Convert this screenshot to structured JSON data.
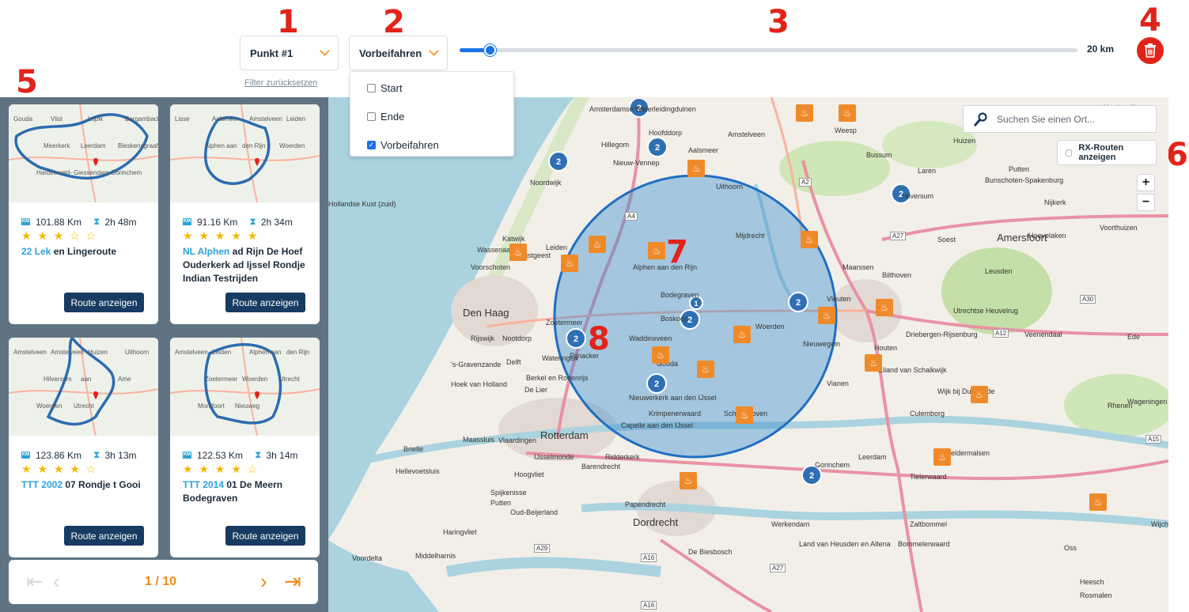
{
  "annotations": [
    "1",
    "2",
    "3",
    "4",
    "5",
    "6",
    "7",
    "8"
  ],
  "filters": {
    "point_select": {
      "value": "Punkt #1"
    },
    "mode_select": {
      "value": "Vorbeifahren"
    },
    "reset_label": "Filter zurücksetzen",
    "mode_options": [
      {
        "label": "Start",
        "checked": false
      },
      {
        "label": "Ende",
        "checked": false
      },
      {
        "label": "Vorbeifahren",
        "checked": true
      }
    ],
    "radius": {
      "value_km": 20,
      "min_km": 0,
      "max_km": 500,
      "label": "20 km"
    },
    "delete_icon": "trash-icon"
  },
  "routes": [
    {
      "km": "101.88 Km",
      "time": "2h 48m",
      "rating": 3,
      "stars": "★ ★ ★ ☆ ☆",
      "title_hl": "22 Lek",
      "title_rest": " en Lingeroute",
      "button": "Route anzeigen",
      "map_labels": [
        "Gouda",
        "Vlist",
        "Lopik",
        "Bergambacht",
        "Meerkerk",
        "Leerdam",
        "Bleskensgraaf",
        "Hardinxveld-",
        "Giessendam",
        "Gorinchem"
      ]
    },
    {
      "km": "91.16 Km",
      "time": "2h 34m",
      "rating": 5,
      "stars": "★ ★ ★ ★ ★",
      "title_hl": "NL Alphen",
      "title_rest": " ad Rijn De Hoef Ouderkerk ad Ijssel Rondje Indian Testrijden",
      "button": "Route anzeigen",
      "map_labels": [
        "Lisse",
        "Aalsmeer",
        "Amstelveen",
        "Leiden",
        "Alphen aan",
        "den Rijn",
        "Woerden"
      ]
    },
    {
      "km": "123.86 Km",
      "time": "3h 13m",
      "rating": 4,
      "stars": "★ ★ ★ ★ ☆",
      "title_hl": "TTT 2002",
      "title_rest": " 07 Rondje t Gooi",
      "button": "Route anzeigen",
      "map_labels": [
        "Amstelveen",
        "Amstelveen",
        "Huizen",
        "Uithoorn",
        "Hilversum",
        "aan",
        "Ame",
        "Woerden",
        "Utrecht"
      ]
    },
    {
      "km": "122.53 Km",
      "time": "3h 14m",
      "rating": 4,
      "stars": "★ ★ ★ ★ ☆",
      "title_hl": "TTT 2014",
      "title_rest": " 01 De Meern Bodegraven",
      "button": "Route anzeigen",
      "map_labels": [
        "Amstelveen",
        "Leiden",
        "Alphen aan",
        "den Rijn",
        "Zoetermeer",
        "Woerden",
        "Utrecht",
        "Montfoort",
        "Nieuweg"
      ]
    }
  ],
  "pagination": {
    "label": "1 / 10"
  },
  "map": {
    "search_placeholder": "Suchen Sie einen Ort...",
    "rx_label": "RX-Routen anzeigen",
    "zoom_in": "+",
    "zoom_out": "−",
    "cluster_counts": [
      "2",
      "2",
      "2",
      "2",
      "2",
      "2",
      "1",
      "2",
      "2",
      "2",
      "2"
    ],
    "places": [
      "Amsterdamse Waterleidingduinen",
      "Hoofddorp",
      "Hillegom",
      "Nieuw-Vennep",
      "Noordwijk",
      "Aalsmeer",
      "Amstelveen",
      "Uithoorn",
      "Weesp",
      "Bussum",
      "Huizen",
      "Laren",
      "Hilversum",
      "Bunschoten-Spakenburg",
      "Putten",
      "Nijkerk",
      "Katwijk",
      "Oegstgeest",
      "Leiden",
      "Wassenaar",
      "Voorschoten",
      "Mijdrecht",
      "Alphen aan den Rijn",
      "Maarssen",
      "Soest",
      "Amersfoort",
      "Hoevelaken",
      "Voorthuizen",
      "Den Haag",
      "Zoetermeer",
      "Bodegraven",
      "Boskoop",
      "Woerden",
      "Vleuten",
      "Bilthoven",
      "Leusden",
      "Utrechtse Heuvelrug",
      "Rijswijk",
      "Nootdorp",
      "Wateringen",
      "Delft",
      "Pijnacker",
      "Waddinxveen",
      "Gouda",
      "Nieuwegein",
      "Houten",
      "Driebergen-Rijsenburg",
      "Veenendaal",
      "Ede",
      "'s-Gravenzande",
      "Berkel en Rodenrijs",
      "Hoek van Holland",
      "De Lier",
      "Eiland van Schalkwijk",
      "Rhenen",
      "Wageningen",
      "Wijk bij Duurstede",
      "Culemborg",
      "Vianen",
      "Nieuwerkerk aan den IJssel",
      "Krimpenerwaard",
      "Schoonhoven",
      "Capelle aan den IJssel",
      "Maassluis",
      "Vlaardingen",
      "Rotterdam",
      "Brielle",
      "Ridderkerk",
      "IJsselmonde",
      "Barendrecht",
      "Hoogvliet",
      "Spijkenisse",
      "Putten",
      "Geldermalsen",
      "Tielerwaard",
      "Leerdam",
      "Gorinchem",
      "Hellevoetsluis",
      "Oud-Beijerland",
      "Papendrecht",
      "Dordrecht",
      "Werkendam",
      "Zaltbommel",
      "Bommelerwaard",
      "Land van Heusden en Altena",
      "Middelharnis",
      "Haringvliet",
      "De Biesbosch",
      "Voordelta",
      "Rosmalen",
      "Heesch",
      "Oss",
      "Wijche",
      "Harderwijk",
      "Hollandse Kust (zuid)"
    ],
    "roads": [
      "A2",
      "A4",
      "A27",
      "A30",
      "A12",
      "A15",
      "A29",
      "A16",
      "A27",
      "A16"
    ]
  }
}
